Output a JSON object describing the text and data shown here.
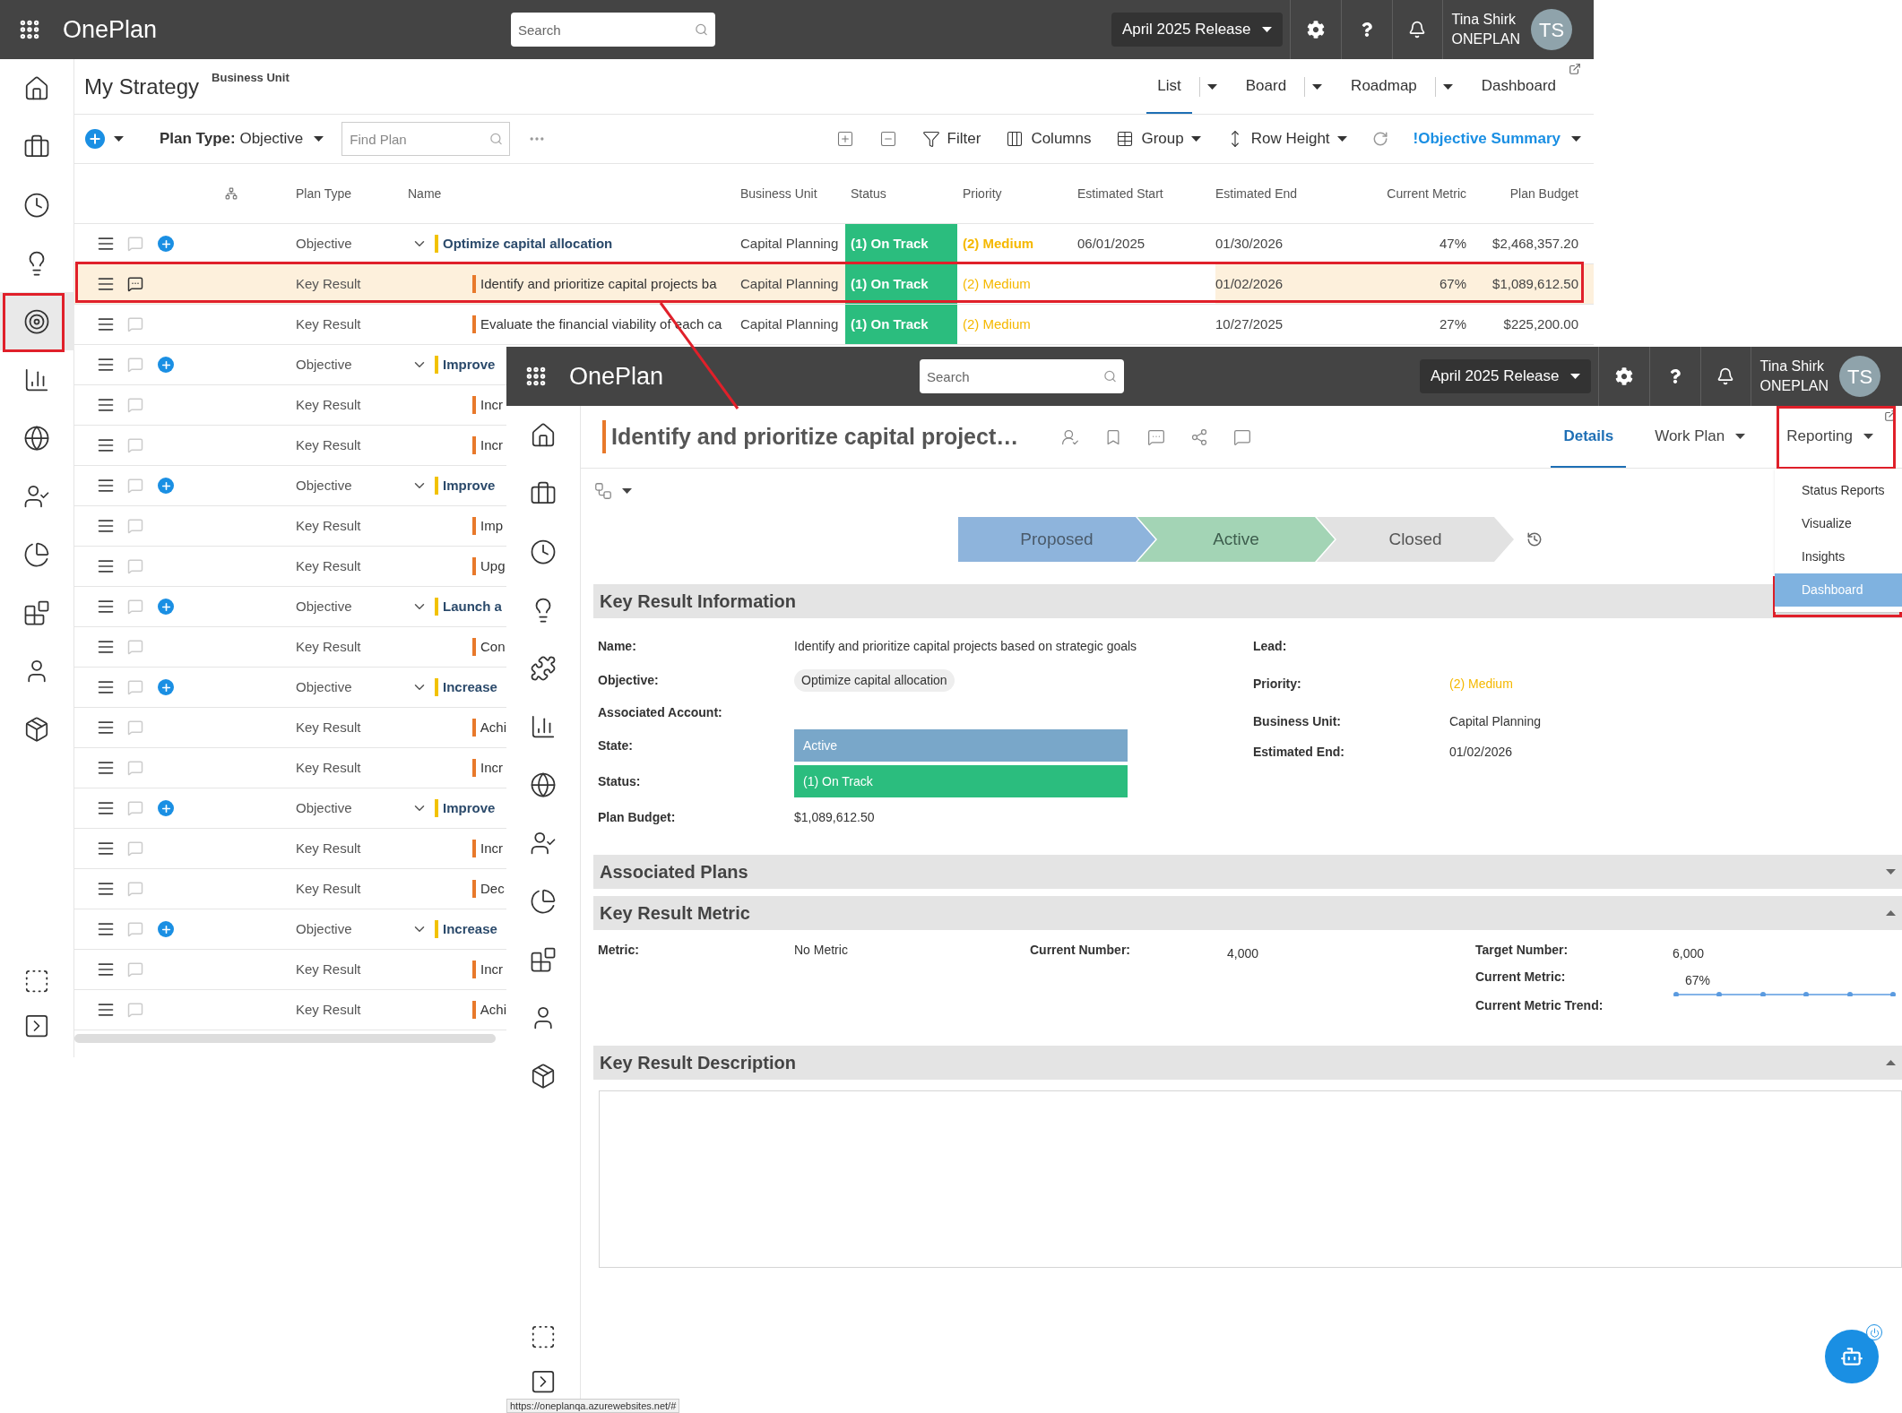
{
  "back_window": {
    "app_name": "OnePlan",
    "search": {
      "placeholder": "Search"
    },
    "release": "April 2025 Release",
    "user": {
      "name": "Tina Shirk",
      "org": "ONEPLAN",
      "initials": "TS"
    },
    "sidebar_items": [
      {
        "kind": "home",
        "selected": false
      },
      {
        "kind": "briefcase",
        "selected": false
      },
      {
        "kind": "clock",
        "selected": false
      },
      {
        "kind": "bulb",
        "selected": false
      },
      {
        "kind": "target",
        "selected": true
      },
      {
        "kind": "chart",
        "selected": false
      },
      {
        "kind": "globe",
        "selected": false
      },
      {
        "kind": "team",
        "selected": false
      },
      {
        "kind": "report",
        "selected": false
      },
      {
        "kind": "blocks",
        "selected": false
      },
      {
        "kind": "person",
        "selected": false
      },
      {
        "kind": "package",
        "selected": false
      }
    ],
    "page_title": "My Strategy",
    "page_subtitle": "Business Unit",
    "views": [
      {
        "label": "List",
        "selected": true,
        "dropdown": true
      },
      {
        "label": "Board",
        "selected": false,
        "dropdown": true
      },
      {
        "label": "Roadmap",
        "selected": false,
        "dropdown": true
      },
      {
        "label": "Dashboard",
        "selected": false,
        "dropdown": false
      }
    ],
    "toolbar": {
      "plan_type": "**Plan Type:** Objective",
      "find_placeholder": "Find Plan",
      "filter": "Filter",
      "columns": "Columns",
      "group": "Group",
      "row_height": "Row Height",
      "summary": "!Objective Summary"
    },
    "table": {
      "columns": [
        "Plan Type",
        "Name",
        "Business Unit",
        "Status",
        "Priority",
        "Estimated Start",
        "Estimated End",
        "Current Metric",
        "Plan Budget"
      ],
      "rows": [
        {
          "kind": "objective",
          "plan_type": "Objective",
          "name": "Optimize capital allocation",
          "business_unit": "Capital Planning",
          "status": "(1) On Track",
          "priority": "(2) Medium",
          "estimated_start": "06/01/2025",
          "estimated_end": "01/30/2026",
          "current_metric": "47%",
          "plan_budget": "$2,468,357.20",
          "selected": false,
          "has_comments": false
        },
        {
          "kind": "key_result",
          "plan_type": "Key Result",
          "name": "Identify and prioritize capital projects ba",
          "business_unit": "Capital Planning",
          "status": "(1) On Track",
          "priority": "(2) Medium",
          "estimated_end": "01/02/2026",
          "current_metric": "67%",
          "plan_budget": "$1,089,612.50",
          "selected": true,
          "has_comments": true
        },
        {
          "kind": "key_result",
          "plan_type": "Key Result",
          "name": "Evaluate the financial viability of each ca",
          "business_unit": "Capital Planning",
          "status": "(1) On Track",
          "priority": "(2) Medium",
          "estimated_end": "10/27/2025",
          "current_metric": "27%",
          "plan_budget": "$225,200.00",
          "selected": false,
          "has_comments": false
        },
        {
          "kind": "objective",
          "plan_type": "Objective",
          "name": "Improve",
          "selected": false,
          "has_comments": false
        },
        {
          "kind": "key_result",
          "plan_type": "Key Result",
          "name": "Incr",
          "selected": false,
          "has_comments": false
        },
        {
          "kind": "key_result",
          "plan_type": "Key Result",
          "name": "Incr",
          "selected": false,
          "has_comments": false
        },
        {
          "kind": "objective",
          "plan_type": "Objective",
          "name": "Improve",
          "selected": false,
          "has_comments": false
        },
        {
          "kind": "key_result",
          "plan_type": "Key Result",
          "name": "Imp",
          "selected": false,
          "has_comments": false
        },
        {
          "kind": "key_result",
          "plan_type": "Key Result",
          "name": "Upg",
          "selected": false,
          "has_comments": false
        },
        {
          "kind": "objective",
          "plan_type": "Objective",
          "name": "Launch a",
          "selected": false,
          "has_comments": false
        },
        {
          "kind": "key_result",
          "plan_type": "Key Result",
          "name": "Con",
          "selected": false,
          "has_comments": false
        },
        {
          "kind": "objective",
          "plan_type": "Objective",
          "name": "Increase",
          "selected": false,
          "has_comments": false
        },
        {
          "kind": "key_result",
          "plan_type": "Key Result",
          "name": "Achi",
          "selected": false,
          "has_comments": false
        },
        {
          "kind": "key_result",
          "plan_type": "Key Result",
          "name": "Incr",
          "selected": false,
          "has_comments": false
        },
        {
          "kind": "objective",
          "plan_type": "Objective",
          "name": "Improve",
          "selected": false,
          "has_comments": false
        },
        {
          "kind": "key_result",
          "plan_type": "Key Result",
          "name": "Incr",
          "selected": false,
          "has_comments": false
        },
        {
          "kind": "key_result",
          "plan_type": "Key Result",
          "name": "Dec",
          "selected": false,
          "has_comments": false
        },
        {
          "kind": "objective",
          "plan_type": "Objective",
          "name": "Increase",
          "selected": false,
          "has_comments": false
        },
        {
          "kind": "key_result",
          "plan_type": "Key Result",
          "name": "Incr",
          "selected": false,
          "has_comments": false
        },
        {
          "kind": "key_result",
          "plan_type": "Key Result",
          "name": "Achi",
          "selected": false,
          "has_comments": false
        }
      ]
    }
  },
  "detail_window": {
    "app_name": "OnePlan",
    "search": {
      "placeholder": "Search"
    },
    "release": "April 2025 Release",
    "user": {
      "name": "Tina Shirk",
      "org": "ONEPLAN",
      "initials": "TS"
    },
    "sidebar_items": [
      {
        "kind": "home",
        "selected": false
      },
      {
        "kind": "briefcase",
        "selected": false
      },
      {
        "kind": "clock",
        "selected": false
      },
      {
        "kind": "bulb",
        "selected": false
      },
      {
        "kind": "puzzle",
        "selected": false
      },
      {
        "kind": "chart",
        "selected": false
      },
      {
        "kind": "globe",
        "selected": false
      },
      {
        "kind": "team",
        "selected": false
      },
      {
        "kind": "report",
        "selected": false
      },
      {
        "kind": "blocks",
        "selected": false
      },
      {
        "kind": "person",
        "selected": false
      },
      {
        "kind": "package",
        "selected": false
      }
    ],
    "title": "Identify and prioritize capital project…",
    "tabs": [
      {
        "label": "Details",
        "selected": true,
        "dropdown": false
      },
      {
        "label": "Work Plan",
        "selected": false,
        "dropdown": true
      },
      {
        "label": "Reporting",
        "selected": false,
        "dropdown": true
      }
    ],
    "reporting_menu": [
      {
        "label": "Status Reports",
        "selected": false
      },
      {
        "label": "Visualize",
        "selected": false
      },
      {
        "label": "Insights",
        "selected": false
      },
      {
        "label": "Dashboard",
        "selected": true
      }
    ],
    "stages": [
      {
        "label": "Proposed",
        "kind": "past"
      },
      {
        "label": "Active",
        "kind": "current"
      },
      {
        "label": "Closed",
        "kind": "future"
      }
    ],
    "key_result_information": {
      "title": "Key Result Information",
      "left_fields": [
        {
          "label": "Name:",
          "value": "Identify and prioritize capital projects based on strategic goals",
          "kind": "text"
        },
        {
          "label": "Objective:",
          "value": "Optimize capital allocation",
          "kind": "chip"
        },
        {
          "label": "Associated Account:",
          "kind": "text"
        },
        {
          "label": "State:",
          "value": "Active",
          "kind": "bar",
          "color": "#79a7c9"
        },
        {
          "label": "Status:",
          "value": "(1) On Track",
          "kind": "bar",
          "color": "#2bbd7e"
        },
        {
          "label": "Plan Budget:",
          "value": "$1,089,612.50",
          "kind": "text"
        }
      ],
      "right_fields": [
        {
          "label": "Lead:",
          "kind": "text"
        },
        {
          "label": "Priority:",
          "value": "(2) Medium",
          "kind": "priority"
        },
        {
          "label": "Business Unit:",
          "value": "Capital Planning",
          "kind": "text"
        },
        {
          "label": "Estimated End:",
          "value": "01/02/2026",
          "kind": "text"
        }
      ]
    },
    "associated_plans": {
      "title": "Associated Plans",
      "expanded": false
    },
    "key_result_metric": {
      "title": "Key Result Metric",
      "expanded": true,
      "metric_label": "Metric:",
      "metric": "No Metric",
      "current_number_label": "Current Number:",
      "current_number": "4,000",
      "target_number_label": "Target Number:",
      "target_number": "6,000",
      "current_metric_label": "Current Metric:",
      "current_metric": "67%",
      "trend_label": "Current Metric Trend:"
    },
    "key_result_description": {
      "title": "Key Result Description",
      "expanded": true
    },
    "status_url": "https://oneplanqa.azurewebsites.net/#"
  }
}
